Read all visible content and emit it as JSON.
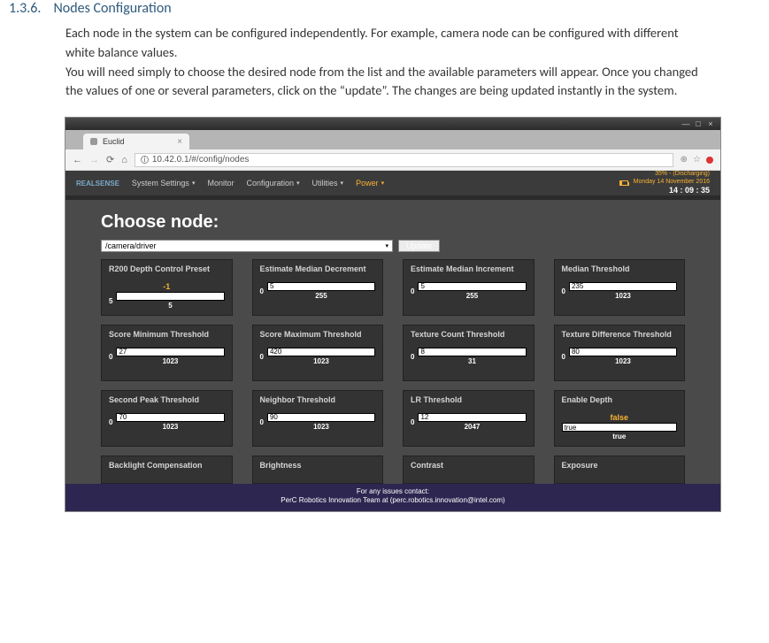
{
  "doc": {
    "heading_number": "1.3.6.",
    "heading_title": "Nodes Configuration",
    "paragraph1": "Each node in the system can be configured independently. For example, camera node can be configured with different white balance values.",
    "paragraph2": "You will need simply to choose the desired node from the list and the available parameters will appear. Once you changed the values of one or several parameters, click on the “update”. The changes are being updated instantly in the system."
  },
  "browser": {
    "tab_title": "Euclid",
    "url": "10.42.0.1/#/config/nodes"
  },
  "nav": {
    "brand": "REALSENSE",
    "items": [
      "System Settings",
      "Monitor",
      "Configuration",
      "Utilities"
    ],
    "power": "Power",
    "battery_text": "35% - (Discharging)",
    "date": "Monday 14 November 2016",
    "time": "14 : 09 : 35"
  },
  "main": {
    "choose_title": "Choose node:",
    "selected_node": "/camera/driver",
    "update_label": "Update"
  },
  "params": [
    {
      "title": "R200 Depth Control Preset",
      "current": "-1",
      "min": "5",
      "max": "5",
      "value_inside": ""
    },
    {
      "title": "Estimate Median Decrement",
      "current": "",
      "min": "0",
      "max": "255",
      "value_inside": "5"
    },
    {
      "title": "Estimate Median Increment",
      "current": "",
      "min": "0",
      "max": "255",
      "value_inside": "5"
    },
    {
      "title": "Median Threshold",
      "current": "",
      "min": "0",
      "max": "1023",
      "value_inside": "235"
    },
    {
      "title": "Score Minimum Threshold",
      "current": "",
      "min": "0",
      "max": "1023",
      "value_inside": "27"
    },
    {
      "title": "Score Maximum Threshold",
      "current": "",
      "min": "0",
      "max": "1023",
      "value_inside": "420"
    },
    {
      "title": "Texture Count Threshold",
      "current": "",
      "min": "0",
      "max": "31",
      "value_inside": "8"
    },
    {
      "title": "Texture Difference Threshold",
      "current": "",
      "min": "0",
      "max": "1023",
      "value_inside": "80"
    },
    {
      "title": "Second Peak Threshold",
      "current": "",
      "min": "0",
      "max": "1023",
      "value_inside": "70"
    },
    {
      "title": "Neighbor Threshold",
      "current": "",
      "min": "0",
      "max": "1023",
      "value_inside": "90"
    },
    {
      "title": "LR Threshold",
      "current": "",
      "min": "0",
      "max": "2047",
      "value_inside": "12"
    },
    {
      "title": "Enable Depth",
      "type": "bool",
      "label": "false",
      "value_inside": "true",
      "max": "true"
    }
  ],
  "params_row4": [
    {
      "title": "Backlight Compensation"
    },
    {
      "title": "Brightness"
    },
    {
      "title": "Contrast"
    },
    {
      "title": "Exposure"
    }
  ],
  "footer": {
    "line1": "For any issues contact:",
    "line2": "PerC Robotics Innovation Team at (perc.robotics.innovation@intel.com)"
  }
}
